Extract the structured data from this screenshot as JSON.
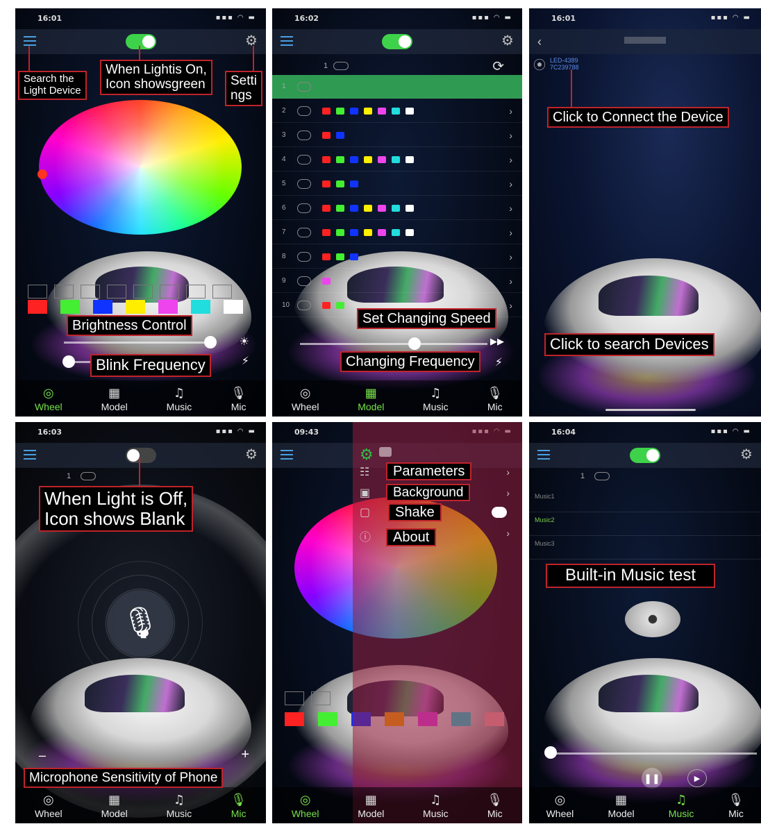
{
  "nav": {
    "wheel": "Wheel",
    "model": "Model",
    "music": "Music",
    "mic": "Mic"
  },
  "colors": {
    "accent": "#3ed24a",
    "label_border": "#c0232a",
    "label_bg": "#000000"
  },
  "icons": [
    "menu-icon",
    "toggle-switch",
    "gear-icon",
    "wheel-icon",
    "model-icon",
    "music-icon",
    "mic-icon"
  ],
  "screen1": {
    "time": "16:01",
    "callout_search": "Search the\nLight Device",
    "callout_light_on": "When Lightis On,\nIcon showsgreen",
    "callout_settings": "Setti\nngs",
    "callout_brightness": "Brightness Control",
    "callout_blink": "Blink Frequency",
    "swatches": [
      "#ff2222",
      "#44ee33",
      "#1133ff",
      "#ffee00",
      "#ee44ee",
      "#22dddd",
      "#ffffff"
    ]
  },
  "screen2": {
    "time": "16:02",
    "rows": [
      {
        "num": "1",
        "colors": []
      },
      {
        "num": "2",
        "colors": [
          "#ff2222",
          "#44ee33",
          "#1133ff",
          "#ffee00",
          "#ee44ee",
          "#22dddd",
          "#ffffff"
        ]
      },
      {
        "num": "3",
        "colors": [
          "#ff2222",
          "#1133ff"
        ]
      },
      {
        "num": "4",
        "colors": [
          "#ff2222",
          "#44ee33",
          "#1133ff",
          "#ffee00",
          "#ee44ee",
          "#22dddd",
          "#ffffff"
        ]
      },
      {
        "num": "5",
        "colors": [
          "#ff2222",
          "#44ee33",
          "#1133ff"
        ]
      },
      {
        "num": "6",
        "colors": [
          "#ff2222",
          "#44ee33",
          "#1133ff",
          "#ffee00",
          "#ee44ee",
          "#22dddd",
          "#ffffff"
        ]
      },
      {
        "num": "7",
        "colors": [
          "#ff2222",
          "#44ee33",
          "#1133ff",
          "#ffee00",
          "#ee44ee",
          "#22dddd",
          "#ffffff"
        ]
      },
      {
        "num": "8",
        "colors": [
          "#ff2222",
          "#44ee33",
          "#1133ff"
        ]
      },
      {
        "num": "9",
        "colors": [
          "#ee44ee"
        ]
      },
      {
        "num": "10",
        "colors": [
          "#ff2222",
          "#44ee33"
        ]
      }
    ],
    "callout_speed": "Set Changing Speed",
    "callout_frequency": "Changing Frequency"
  },
  "screen3": {
    "time": "16:01",
    "device_name": "LED-4389",
    "device_id": "7C239788",
    "callout_connect": "Click to Connect the Device",
    "callout_search": "Click to search Devices"
  },
  "screen4": {
    "time": "16:03",
    "callout_off": "When Light is Off,\nIcon shows Blank",
    "callout_mic": "Microphone Sensitivity of Phone",
    "minus": "–",
    "plus": "+"
  },
  "screen5": {
    "time": "09:43",
    "menu": [
      "Parameters",
      "Background",
      "Shake",
      "About"
    ],
    "swatches": [
      "#ff2222",
      "#44ee33",
      "#1133ff",
      "#ffaa00",
      "#ee44ee",
      "#22dddd",
      "#ffaaaa"
    ]
  },
  "screen6": {
    "time": "16:04",
    "songs": [
      "Music1",
      "Music2",
      "Music3"
    ],
    "callout_music": "Built-in Music test"
  }
}
